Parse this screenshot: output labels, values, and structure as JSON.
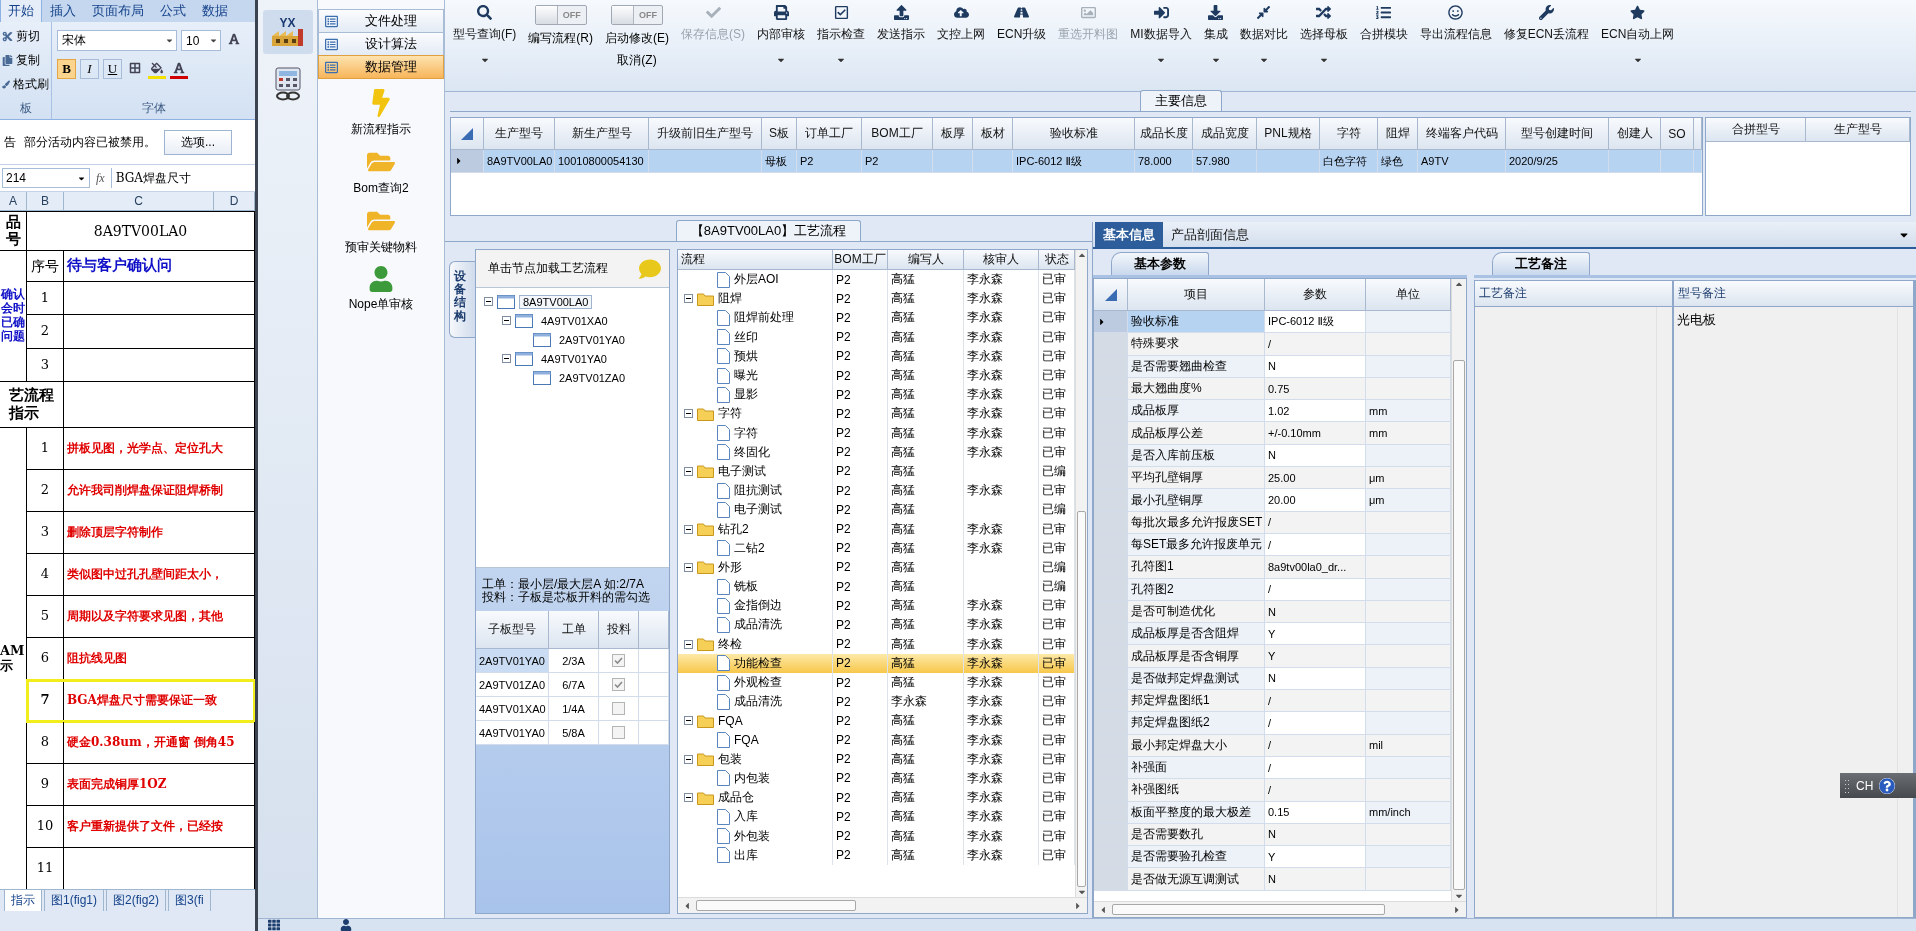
{
  "spreadsheet": {
    "ribbon_tabs": [
      {
        "label": "开始",
        "selected": true
      },
      {
        "label": "插入",
        "selected": false
      },
      {
        "label": "页面布局",
        "selected": false
      },
      {
        "label": "公式",
        "selected": false
      },
      {
        "label": "数据",
        "selected": false
      }
    ],
    "clipboard": [
      "剪切",
      "复制",
      "格式刷"
    ],
    "clipboard_group": "板",
    "font_name": "宋体",
    "font_size": "10",
    "format_buttons": [
      "B",
      "I",
      "U"
    ],
    "font_group": "字体",
    "warning": {
      "label": "告",
      "message": "部分活动内容已被禁用。",
      "button": "选项..."
    },
    "name_box": "214",
    "function_label": "fx",
    "formula": "BGA焊盘尺寸",
    "columns": [
      "A",
      "B",
      "C",
      "D"
    ],
    "product": {
      "label": "品号",
      "value": "8A9TV00LA0"
    },
    "questions": {
      "label": "确认会时已确问题",
      "index_header": "序号",
      "title": "待与客户确认问",
      "numbers": [
        "1",
        "2",
        "3"
      ]
    },
    "process_label": "艺流程指示",
    "instructions": {
      "label": "AM示",
      "rows": [
        {
          "no": "1",
          "text": "拼板见图，光学点、定位孔大",
          "highlighted": false
        },
        {
          "no": "2",
          "text": "允许我司削焊盘保证阻焊桥制",
          "highlighted": false
        },
        {
          "no": "3",
          "text": "删除顶层字符制作",
          "highlighted": false
        },
        {
          "no": "4",
          "text": "类似图中过孔孔壁间距太小，",
          "highlighted": false
        },
        {
          "no": "5",
          "text": "周期以及字符要求见图，其他",
          "highlighted": false
        },
        {
          "no": "6",
          "text": "阻抗线见图",
          "highlighted": false
        },
        {
          "no": "7",
          "text": "BGA焊盘尺寸需要保证一致",
          "highlighted": true
        },
        {
          "no": "8",
          "text": "硬金0.38um，开通窗 倒角45",
          "highlighted": false
        },
        {
          "no": "9",
          "text": "表面完成铜厚1OZ",
          "highlighted": false
        },
        {
          "no": "10",
          "text": "客户重新提供了文件，已经按",
          "highlighted": false
        },
        {
          "no": "11",
          "highlighted": false
        }
      ]
    },
    "sheet_tabs": [
      {
        "label": "指示",
        "selected": true
      },
      {
        "label": "图1(fig1)",
        "selected": false
      },
      {
        "label": "图2(fig2)",
        "selected": false
      },
      {
        "label": "图3(fi",
        "selected": false
      }
    ]
  },
  "modules": [
    {
      "logo": "YX",
      "selected": true
    },
    {
      "selected": false
    }
  ],
  "nav": {
    "sections": [
      {
        "label": "文件处理",
        "selected": false
      },
      {
        "label": "设计算法",
        "selected": false
      },
      {
        "label": "数据管理",
        "selected": true
      }
    ],
    "items": [
      {
        "label": "新流程指示"
      },
      {
        "label": "Bom查询2"
      },
      {
        "label": "预审关键物料"
      },
      {
        "label": "Nope单审核"
      }
    ]
  },
  "toolbar": [
    {
      "kind": "button",
      "label": "型号查询(F)",
      "dropdown": true,
      "disabled": false
    },
    {
      "kind": "toggle",
      "switch": "OFF",
      "on": false,
      "label": "编写流程(R)"
    },
    {
      "kind": "toggle",
      "switch": "OFF",
      "on": false,
      "label": "启动修改(E)",
      "sublabel": "取消(Z)"
    },
    {
      "kind": "button",
      "label": "保存信息(S)",
      "dropdown": false,
      "disabled": true
    },
    {
      "kind": "button",
      "label": "内部审核",
      "dropdown": true,
      "disabled": false
    },
    {
      "kind": "button",
      "label": "指示检查",
      "dropdown": true,
      "disabled": false
    },
    {
      "kind": "button",
      "label": "发送指示",
      "dropdown": false,
      "disabled": false
    },
    {
      "kind": "button",
      "label": "文控上网",
      "dropdown": false,
      "disabled": false
    },
    {
      "kind": "button",
      "label": "ECN升级",
      "dropdown": false,
      "disabled": false
    },
    {
      "kind": "button",
      "label": "重选开料图",
      "dropdown": false,
      "disabled": true
    },
    {
      "kind": "button",
      "label": "MI数据导入",
      "dropdown": true,
      "disabled": false
    },
    {
      "kind": "button",
      "label": "集成",
      "dropdown": true,
      "disabled": false
    },
    {
      "kind": "button",
      "label": "数据对比",
      "dropdown": true,
      "disabled": false
    },
    {
      "kind": "button",
      "label": "选择母板",
      "dropdown": true,
      "disabled": false
    },
    {
      "kind": "button",
      "label": "合拼模块",
      "dropdown": false,
      "disabled": false
    },
    {
      "kind": "button",
      "label": "导出流程信息",
      "dropdown": false,
      "disabled": false
    },
    {
      "kind": "button",
      "label": "修复ECN丢流程",
      "dropdown": false,
      "disabled": false
    },
    {
      "kind": "button",
      "label": "ECN自动上网",
      "dropdown": true,
      "disabled": false
    }
  ],
  "main_info": {
    "title": "主要信息",
    "row_selected": true,
    "columns": [
      {
        "label": "生产型号",
        "value": "8A9TV00LA0"
      },
      {
        "label": "新生产型号",
        "value": "10010800054130"
      },
      {
        "label": "升级前旧生产型号"
      },
      {
        "label": "S板",
        "value": "母板"
      },
      {
        "label": "订单工厂",
        "value": "P2"
      },
      {
        "label": "BOM工厂",
        "value": "P2"
      },
      {
        "label": "板厚"
      },
      {
        "label": "板材"
      },
      {
        "label": "验收标准",
        "value": "IPC-6012 Ⅱ级"
      },
      {
        "label": "成品长度",
        "value": "78.000"
      },
      {
        "label": "成品宽度",
        "value": "57.980"
      },
      {
        "label": "PNL规格"
      },
      {
        "label": "字符",
        "value": "白色字符"
      },
      {
        "label": "阻焊",
        "value": "绿色"
      },
      {
        "label": "终端客户代码",
        "value": "A9TV"
      },
      {
        "label": "型号创建时间",
        "value": "2020/9/25"
      },
      {
        "label": "创建人"
      },
      {
        "label": "SO"
      }
    ]
  },
  "merge_table": {
    "columns": [
      "合拼型号",
      "生产型号"
    ]
  },
  "process": {
    "title": "【8A9TV00LA0】工艺流程",
    "side_tab": "设备结构",
    "tree_hint": "单击节点加载工艺流程",
    "tree": [
      {
        "label": "8A9TV00LA0",
        "selected": true,
        "expanded": true,
        "children": [
          {
            "label": "4A9TV01XA0",
            "selected": false,
            "expanded": true,
            "children": [
              {
                "label": "2A9TV01YA0",
                "selected": false
              }
            ]
          },
          {
            "label": "4A9TV01YA0",
            "selected": false,
            "expanded": true,
            "children": [
              {
                "label": "2A9TV01ZA0",
                "selected": false
              }
            ]
          }
        ]
      }
    ],
    "notes": [
      "工单：最小层/最大层A 如:2/7A",
      "投料：子板是芯板开料的需勾选"
    ],
    "subboards": {
      "columns": [
        "子板型号",
        "工单",
        "投料"
      ],
      "rows": [
        {
          "model": "2A9TV01YA0",
          "order": "2/3A",
          "checked": true,
          "selected": true
        },
        {
          "model": "2A9TV01ZA0",
          "order": "6/7A",
          "checked": true,
          "selected": false
        },
        {
          "model": "4A9TV01XA0",
          "order": "1/4A",
          "checked": false,
          "selected": false
        },
        {
          "model": "4A9TV01YA0",
          "order": "5/8A",
          "checked": false,
          "selected": false
        }
      ]
    },
    "flow": {
      "columns": [
        "流程",
        "BOM工厂",
        "编写人",
        "核审人",
        "状态"
      ],
      "rows": [
        {
          "kind": "continued",
          "children": [
            {
              "kind": "leaf",
              "name": "外层AOI",
              "bom": "P2",
              "writer": "高猛",
              "reviewer": "李永森",
              "status": "已审",
              "selected": false
            }
          ]
        },
        {
          "kind": "group",
          "name": "阻焊",
          "bom": "P2",
          "writer": "高猛",
          "reviewer": "李永森",
          "status": "已审",
          "selected": false,
          "expanded": true,
          "children": [
            {
              "kind": "leaf",
              "name": "阻焊前处理",
              "bom": "P2",
              "writer": "高猛",
              "reviewer": "李永森",
              "status": "已审",
              "selected": false
            },
            {
              "kind": "leaf",
              "name": "丝印",
              "bom": "P2",
              "writer": "高猛",
              "reviewer": "李永森",
              "status": "已审",
              "selected": false
            },
            {
              "kind": "leaf",
              "name": "预烘",
              "bom": "P2",
              "writer": "高猛",
              "reviewer": "李永森",
              "status": "已审",
              "selected": false
            },
            {
              "kind": "leaf",
              "name": "曝光",
              "bom": "P2",
              "writer": "高猛",
              "reviewer": "李永森",
              "status": "已审",
              "selected": false
            },
            {
              "kind": "leaf",
              "name": "显影",
              "bom": "P2",
              "writer": "高猛",
              "reviewer": "李永森",
              "status": "已审",
              "selected": false
            }
          ]
        },
        {
          "kind": "group",
          "name": "字符",
          "bom": "P2",
          "writer": "高猛",
          "reviewer": "李永森",
          "status": "已审",
          "selected": false,
          "expanded": true,
          "children": [
            {
              "kind": "leaf",
              "name": "字符",
              "bom": "P2",
              "writer": "高猛",
              "reviewer": "李永森",
              "status": "已审",
              "selected": false
            },
            {
              "kind": "leaf",
              "name": "终固化",
              "bom": "P2",
              "writer": "高猛",
              "reviewer": "李永森",
              "status": "已审",
              "selected": false
            }
          ]
        },
        {
          "kind": "group",
          "name": "电子测试",
          "bom": "P2",
          "writer": "高猛",
          "status": "已编",
          "selected": false,
          "expanded": true,
          "children": [
            {
              "kind": "leaf",
              "name": "阻抗测试",
              "bom": "P2",
              "writer": "高猛",
              "reviewer": "李永森",
              "status": "已审",
              "selected": false
            },
            {
              "kind": "leaf",
              "name": "电子测试",
              "bom": "P2",
              "writer": "高猛",
              "status": "已编",
              "selected": false
            }
          ]
        },
        {
          "kind": "group",
          "name": "钻孔2",
          "bom": "P2",
          "writer": "高猛",
          "reviewer": "李永森",
          "status": "已审",
          "selected": false,
          "expanded": true,
          "children": [
            {
              "kind": "leaf",
              "name": "二钻2",
              "bom": "P2",
              "writer": "高猛",
              "reviewer": "李永森",
              "status": "已审",
              "selected": false
            }
          ]
        },
        {
          "kind": "group",
          "name": "外形",
          "bom": "P2",
          "writer": "高猛",
          "status": "已编",
          "selected": false,
          "expanded": true,
          "children": [
            {
              "kind": "leaf",
              "name": "铣板",
              "bom": "P2",
              "writer": "高猛",
              "status": "已编",
              "selected": false
            },
            {
              "kind": "leaf",
              "name": "金指倒边",
              "bom": "P2",
              "writer": "高猛",
              "reviewer": "李永森",
              "status": "已审",
              "selected": false
            },
            {
              "kind": "leaf",
              "name": "成品清洗",
              "bom": "P2",
              "writer": "高猛",
              "reviewer": "李永森",
              "status": "已审",
              "selected": false
            }
          ]
        },
        {
          "kind": "group",
          "name": "终检",
          "bom": "P2",
          "writer": "高猛",
          "reviewer": "李永森",
          "status": "已审",
          "selected": false,
          "expanded": true,
          "children": [
            {
              "kind": "leaf",
              "name": "功能检查",
              "bom": "P2",
              "writer": "高猛",
              "reviewer": "李永森",
              "status": "已审",
              "selected": true
            },
            {
              "kind": "leaf",
              "name": "外观检查",
              "bom": "P2",
              "writer": "高猛",
              "reviewer": "李永森",
              "status": "已审",
              "selected": false
            },
            {
              "kind": "leaf",
              "name": "成品清洗",
              "bom": "P2",
              "writer": "李永森",
              "reviewer": "李永森",
              "status": "已审",
              "selected": false
            }
          ]
        },
        {
          "kind": "group",
          "name": "FQA",
          "bom": "P2",
          "writer": "高猛",
          "reviewer": "李永森",
          "status": "已审",
          "selected": false,
          "expanded": true,
          "children": [
            {
              "kind": "leaf",
              "name": "FQA",
              "bom": "P2",
              "writer": "高猛",
              "reviewer": "李永森",
              "status": "已审",
              "selected": false
            }
          ]
        },
        {
          "kind": "group",
          "name": "包装",
          "bom": "P2",
          "writer": "高猛",
          "reviewer": "李永森",
          "status": "已审",
          "selected": false,
          "expanded": true,
          "children": [
            {
              "kind": "leaf",
              "name": "内包装",
              "bom": "P2",
              "writer": "高猛",
              "reviewer": "李永森",
              "status": "已审",
              "selected": false
            }
          ]
        },
        {
          "kind": "group",
          "name": "成品仓",
          "bom": "P2",
          "writer": "高猛",
          "reviewer": "李永森",
          "status": "已审",
          "selected": false,
          "expanded": true,
          "children": [
            {
              "kind": "leaf",
              "name": "入库",
              "bom": "P2",
              "writer": "高猛",
              "reviewer": "李永森",
              "status": "已审",
              "selected": false
            },
            {
              "kind": "leaf",
              "name": "外包装",
              "bom": "P2",
              "writer": "高猛",
              "reviewer": "李永森",
              "status": "已审",
              "selected": false
            },
            {
              "kind": "leaf",
              "name": "出库",
              "bom": "P2",
              "writer": "高猛",
              "reviewer": "李永森",
              "status": "已审",
              "selected": false
            }
          ]
        }
      ]
    }
  },
  "detail_tabs": [
    {
      "label": "基本信息",
      "selected": true
    },
    {
      "label": "产品剖面信息",
      "selected": false
    }
  ],
  "basic_params": {
    "subtab": "基本参数",
    "columns": [
      "项目",
      "参数",
      "单位"
    ],
    "rows": [
      {
        "item": "验收标准",
        "value": "IPC-6012 Ⅱ级",
        "selected": true
      },
      {
        "item": "特殊要求",
        "value": "/",
        "selected": false
      },
      {
        "item": "是否需要翘曲检查",
        "value": "N",
        "selected": false
      },
      {
        "item": "最大翘曲度%",
        "value": "0.75",
        "selected": false
      },
      {
        "item": "成品板厚",
        "value": "1.02",
        "unit": "mm",
        "selected": false
      },
      {
        "item": "成品板厚公差",
        "value": "+/-0.10mm",
        "unit": "mm",
        "selected": false
      },
      {
        "item": "是否入库前压板",
        "value": "N",
        "selected": false
      },
      {
        "item": "平均孔壁铜厚",
        "value": "25.00",
        "unit": "μm",
        "selected": false
      },
      {
        "item": "最小孔壁铜厚",
        "value": "20.00",
        "unit": "μm",
        "selected": false
      },
      {
        "item": "每批次最多允许报废SET",
        "value": "/",
        "selected": false
      },
      {
        "item": "每SET最多允许报废单元",
        "value": "/",
        "selected": false
      },
      {
        "item": "孔符图1",
        "value": "8a9tv00la0_dr...",
        "selected": false
      },
      {
        "item": "孔符图2",
        "value": "/",
        "selected": false
      },
      {
        "item": "是否可制造优化",
        "value": "N",
        "selected": false
      },
      {
        "item": "成品板厚是否含阻焊",
        "value": "Y",
        "selected": false
      },
      {
        "item": "成品板厚是否含铜厚",
        "value": "Y",
        "selected": false
      },
      {
        "item": "是否做邦定焊盘测试",
        "value": "N",
        "selected": false
      },
      {
        "item": "邦定焊盘图纸1",
        "value": "/",
        "selected": false
      },
      {
        "item": "邦定焊盘图纸2",
        "value": "/",
        "selected": false
      },
      {
        "item": "最小邦定焊盘大小",
        "value": "/",
        "unit": "mil",
        "selected": false
      },
      {
        "item": "补强面",
        "value": "/",
        "selected": false
      },
      {
        "item": "补强图纸",
        "value": "/",
        "selected": false
      },
      {
        "item": "板面平整度的最大极差",
        "value": "0.15",
        "unit": "mm/inch",
        "selected": false
      },
      {
        "item": "是否需要数孔",
        "value": "N",
        "selected": false
      },
      {
        "item": "是否需要验孔检查",
        "value": "Y",
        "selected": false
      },
      {
        "item": "是否做无源互调测试",
        "value": "N",
        "selected": false
      }
    ]
  },
  "remarks": {
    "subtab": "工艺备注",
    "columns": [
      "工艺备注",
      "型号备注"
    ],
    "model_remark": "光电板"
  },
  "language_bar": {
    "label": "CH"
  }
}
